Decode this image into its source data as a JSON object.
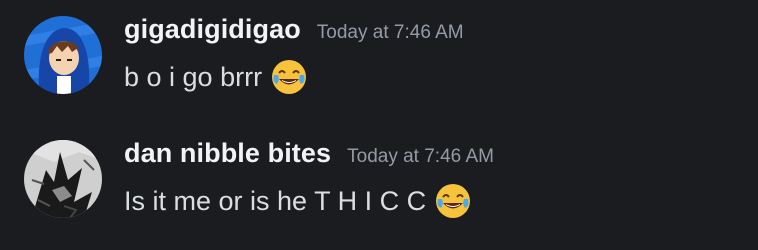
{
  "messages": [
    {
      "username": "gigadigidigao",
      "timestamp": "Today at 7:46 AM",
      "text": "b o i go brrr",
      "emoji": "face-with-tears-of-joy",
      "avatar": "blue-hoodie-avatar"
    },
    {
      "username": "dan nibble bites",
      "timestamp": "Today at 7:46 AM",
      "text": "Is it me or is he T H I C C",
      "emoji": "face-with-tears-of-joy",
      "avatar": "sketch-drawing-avatar"
    }
  ],
  "colors": {
    "background": "#1b1c20",
    "username": "#f2f3f5",
    "timestamp": "#949ba4",
    "message_text": "#dbdee1"
  }
}
